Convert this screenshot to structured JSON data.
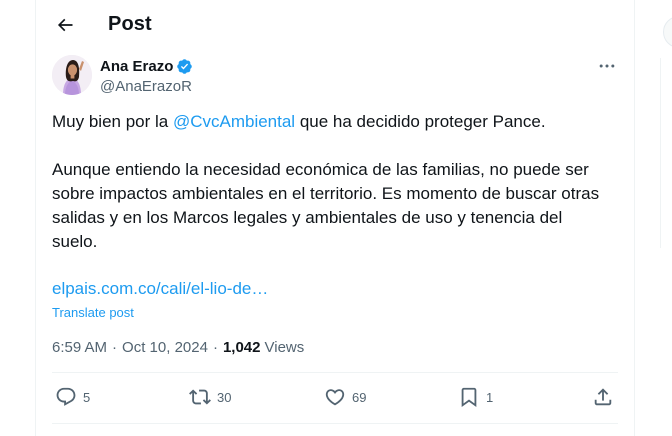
{
  "header": {
    "title": "Post",
    "back_icon": "arrow-left-icon"
  },
  "author": {
    "display_name": "Ana Erazo",
    "handle": "@AnaErazoR",
    "verified": true,
    "verified_color": "#1d9bf0",
    "avatar_icon": "profile-photo"
  },
  "tweet": {
    "line1_before": "Muy bien por la ",
    "mention": "@CvcAmbiental",
    "line1_after": " que ha decidido proteger Pance.",
    "para2": "Aunque entiendo la necesidad económica de las familias, no puede ser sobre impactos ambientales en el territorio. Es momento de buscar otras salidas y en los Marcos legales y ambientales de uso y tenencia del suelo.",
    "link": "elpais.com.co/cali/el-lio-de…",
    "translate": "Translate post"
  },
  "meta": {
    "time": "6:59 AM",
    "date": "Oct 10, 2024",
    "separator": "·",
    "views_count": "1,042",
    "views_label": "Views"
  },
  "actions": {
    "replies": "5",
    "reposts": "30",
    "likes": "69",
    "bookmarks": "1"
  },
  "colors": {
    "accent": "#1d9bf0",
    "text_primary": "#0f1419",
    "text_secondary": "#536471",
    "border": "#eff3f4"
  }
}
